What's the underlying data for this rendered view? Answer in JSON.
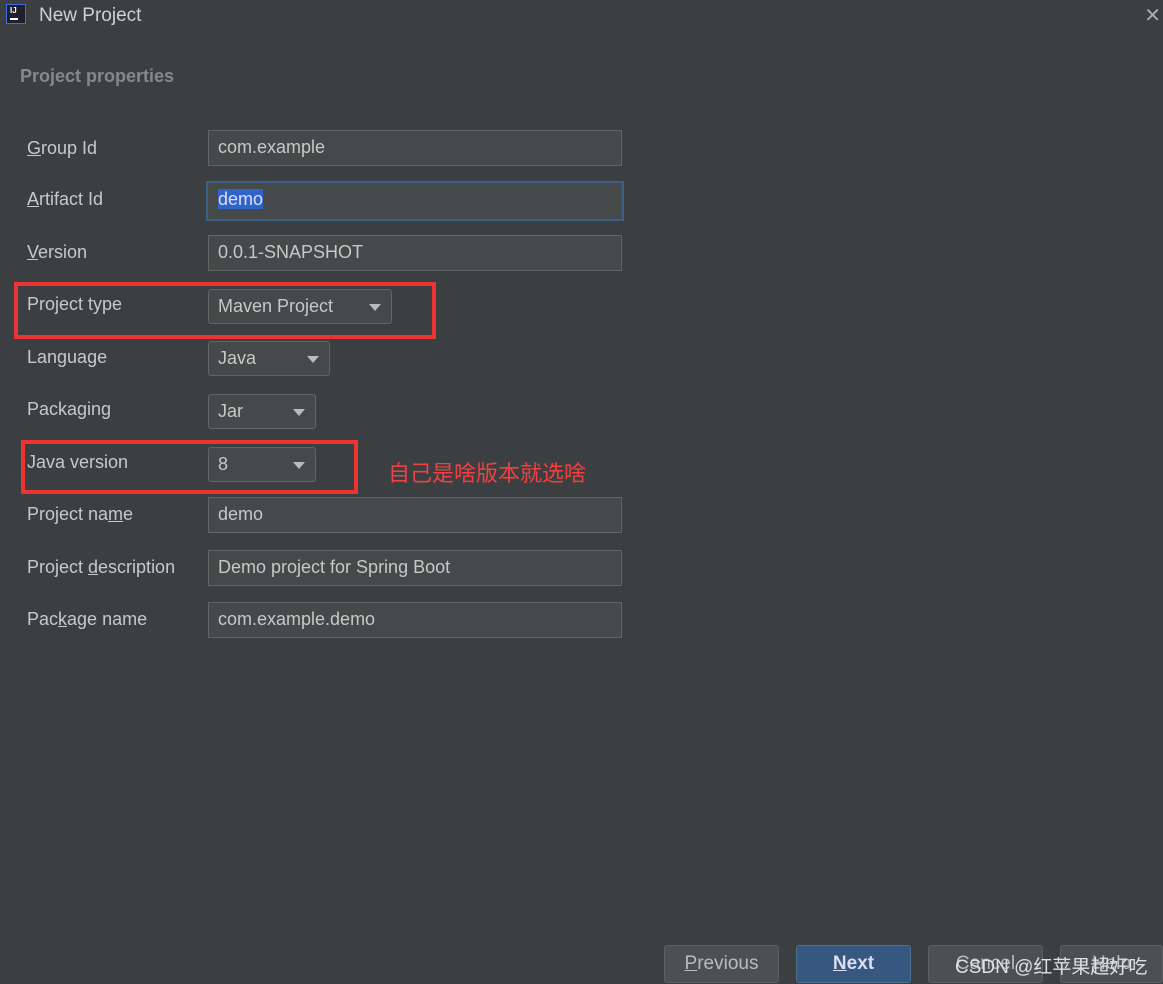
{
  "window": {
    "title": "New Project",
    "close_glyph": "✕",
    "icon_text": "IJ"
  },
  "section_title": "Project properties",
  "form": {
    "group_id": {
      "label_u": "G",
      "label_rest": "roup Id",
      "value": "com.example"
    },
    "artifact_id": {
      "label_u": "A",
      "label_rest": "rtifact Id",
      "value": "demo"
    },
    "version": {
      "label_u": "V",
      "label_rest": "ersion",
      "value": "0.0.1-SNAPSHOT"
    },
    "project_type": {
      "label": "Project type",
      "value": "Maven Project"
    },
    "language": {
      "label": "Language",
      "value": "Java"
    },
    "packaging": {
      "label": "Packaging",
      "value": "Jar"
    },
    "java_version": {
      "label": "Java version",
      "value": "8"
    },
    "project_name": {
      "label_pre": "Project na",
      "label_u": "m",
      "label_post": "e",
      "value": "demo"
    },
    "project_description": {
      "label_pre": "Project ",
      "label_u": "d",
      "label_post": "escription",
      "value": "Demo project for Spring Boot"
    },
    "package_name": {
      "label_pre": "Pac",
      "label_u": "k",
      "label_post": "age name",
      "value": "com.example.demo"
    }
  },
  "annotation": "自己是啥版本就选啥",
  "buttons": {
    "previous": {
      "u": "P",
      "rest": "revious"
    },
    "next": {
      "u": "N",
      "rest": "ext"
    },
    "cancel": "Cancel",
    "help": "Help"
  },
  "watermark": "CSDN @红苹果超好吃",
  "colors": {
    "accent": "#365880",
    "annotation": "#ee3333",
    "background": "#3c3f41"
  }
}
